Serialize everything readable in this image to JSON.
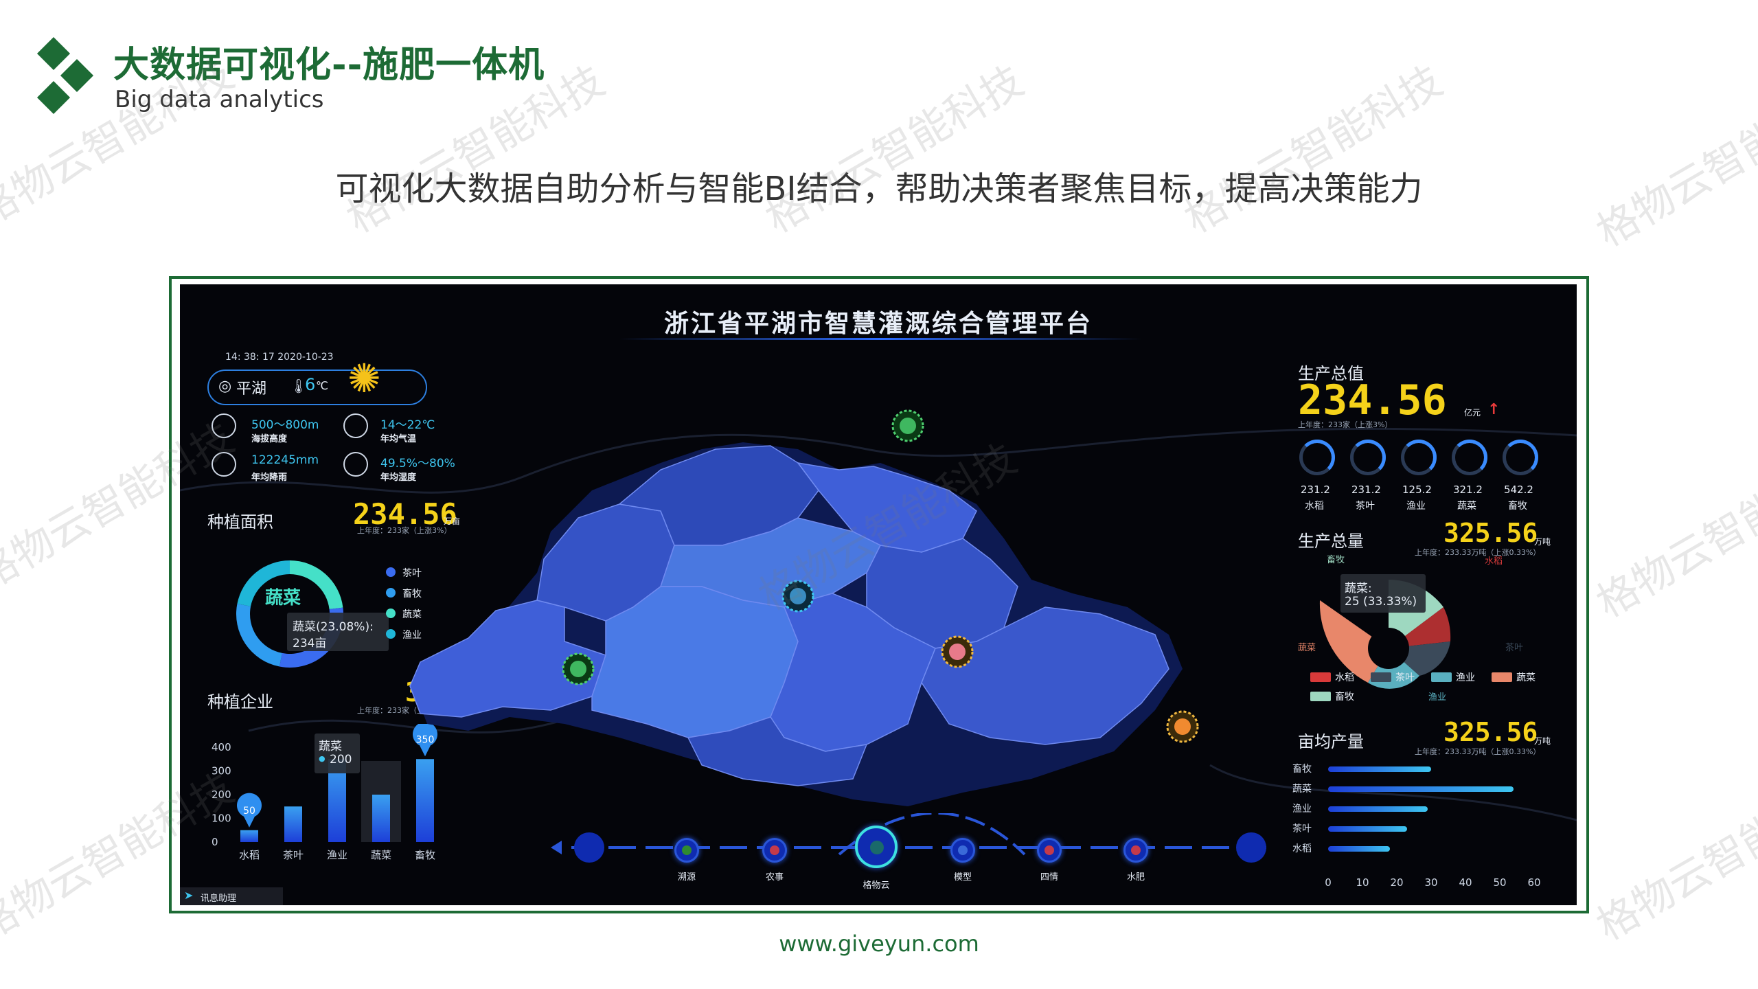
{
  "header": {
    "title": "大数据可视化--施肥一体机",
    "subtitle": "Big data analytics",
    "slogan": "可视化大数据自助分析与智能BI结合，帮助决策者聚焦目标，提高决策能力",
    "watermark": "格物云智能科技",
    "footer_url": "www.giveyun.com"
  },
  "dashboard": {
    "title": "浙江省平湖市智慧灌溉综合管理平台",
    "clock": "14: 38: 17   2020-10-23",
    "location": "平湖",
    "temperature": "6",
    "temp_unit": "℃",
    "stats": [
      {
        "value": "500～800m",
        "label": "海拔高度",
        "icon": "mountain-icon"
      },
      {
        "value": "14～22℃",
        "label": "年均气温",
        "icon": "thermometer-icon"
      },
      {
        "value": "122245mm",
        "label": "年均降雨",
        "icon": "rain-icon"
      },
      {
        "value": "49.5%～80%",
        "label": "年均湿度",
        "icon": "drop-icon"
      }
    ],
    "planting_area": {
      "label": "种植面积",
      "value": "234.56",
      "unit": "万亩",
      "sub": "上年度：233家（上涨3%）",
      "center": "蔬菜",
      "tooltip_line1": "蔬菜(23.08%):",
      "tooltip_line2": "234亩",
      "legend": [
        "茶叶",
        "畜牧",
        "蔬菜",
        "渔业"
      ],
      "legend_colors": [
        "#3a6cf0",
        "#2f9df0",
        "#45e0c8",
        "#1fb6d8"
      ]
    },
    "planting_enterprise": {
      "label": "种植企业",
      "value": "325",
      "unit": "家",
      "sub": "上年度：233家（上涨3%）",
      "tooltip_title": "蔬菜",
      "tooltip_value": "200",
      "pin_labels": [
        "50",
        "350"
      ]
    },
    "production_value": {
      "label": "生产总值",
      "value": "234.56",
      "unit": "亿元",
      "sub": "上年度：233家（上涨3%）",
      "gauges": [
        {
          "value": "231.2",
          "label": "水稻"
        },
        {
          "value": "231.2",
          "label": "茶叶"
        },
        {
          "value": "125.2",
          "label": "渔业"
        },
        {
          "value": "321.2",
          "label": "蔬菜"
        },
        {
          "value": "542.2",
          "label": "畜牧"
        }
      ]
    },
    "production_total": {
      "label": "生产总量",
      "value": "325.56",
      "unit": "万吨",
      "sub": "上年度：233.33万吨（上涨0.33%）",
      "tooltip_line1": "蔬菜:",
      "tooltip_line2": "25 (33.33%)",
      "slice_labels": [
        "畜牧",
        "水稻",
        "蔬菜",
        "茶叶",
        "渔业"
      ],
      "legend": [
        "水稻",
        "茶叶",
        "渔业",
        "蔬菜",
        "畜牧"
      ],
      "legend_colors": [
        "#d83a3a",
        "#3b4a5a",
        "#5ab0c0",
        "#e8876a",
        "#9ed8c0"
      ]
    },
    "yield_per_mu": {
      "label": "亩均产量",
      "value": "325.56",
      "unit": "万吨",
      "sub": "上年度：233.33万吨（上涨0.33%）"
    },
    "nav": {
      "items": [
        "溯源",
        "农事",
        "格物云",
        "模型",
        "四情",
        "水肥"
      ],
      "badge": "讯息助理"
    }
  },
  "chart_data": [
    {
      "type": "bar",
      "title": "种植企业",
      "categories": [
        "水稻",
        "茶叶",
        "渔业",
        "蔬菜",
        "畜牧"
      ],
      "values": [
        50,
        150,
        350,
        200,
        350
      ],
      "yticks": [
        "0",
        "100",
        "200",
        "300",
        "400"
      ],
      "ylim": [
        0,
        400
      ]
    },
    {
      "type": "bar",
      "title": "亩均产量",
      "orientation": "horizontal",
      "categories": [
        "畜牧",
        "蔬菜",
        "渔业",
        "茶叶",
        "水稻"
      ],
      "values": [
        30,
        54,
        29,
        23,
        18
      ],
      "xticks": [
        "0",
        "10",
        "20",
        "30",
        "40",
        "50",
        "60"
      ],
      "xlim": [
        0,
        60
      ]
    },
    {
      "type": "pie",
      "title": "种植面积",
      "categories": [
        "蔬菜",
        "茶叶",
        "畜牧",
        "渔业"
      ],
      "values": [
        23.08,
        30,
        25,
        21.92
      ]
    }
  ]
}
